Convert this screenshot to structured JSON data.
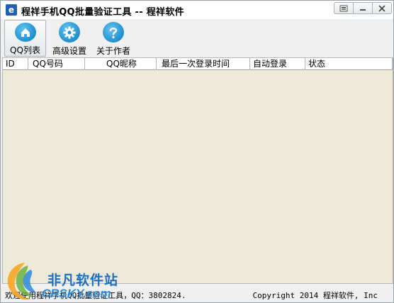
{
  "window": {
    "title": "程祥手机QQ批量验证工具 -- 程祥软件",
    "app_icon_glyph": "e"
  },
  "toolbar": {
    "buttons": [
      {
        "label": "QQ列表",
        "icon": "home-icon",
        "active": true
      },
      {
        "label": "高级设置",
        "icon": "gear-icon",
        "active": false
      },
      {
        "label": "关于作者",
        "icon": "question-icon",
        "active": false
      }
    ]
  },
  "table": {
    "columns": [
      "ID",
      "QQ号码",
      "QQ昵称",
      "最后一次登录时间",
      "自动登录",
      "状态"
    ],
    "rows": []
  },
  "statusbar": {
    "left": "欢迎使用程祥手机QQ批量验证工具，QQ：3802824.",
    "right": "Copyright 2014 程祥软件, Inc"
  },
  "watermark": {
    "line1": "非凡软件站",
    "line2": "CRSKY.com"
  },
  "colors": {
    "accent": "#1e8fd1",
    "list_background": "#ece9d8",
    "window_background": "#f0f0f0"
  }
}
